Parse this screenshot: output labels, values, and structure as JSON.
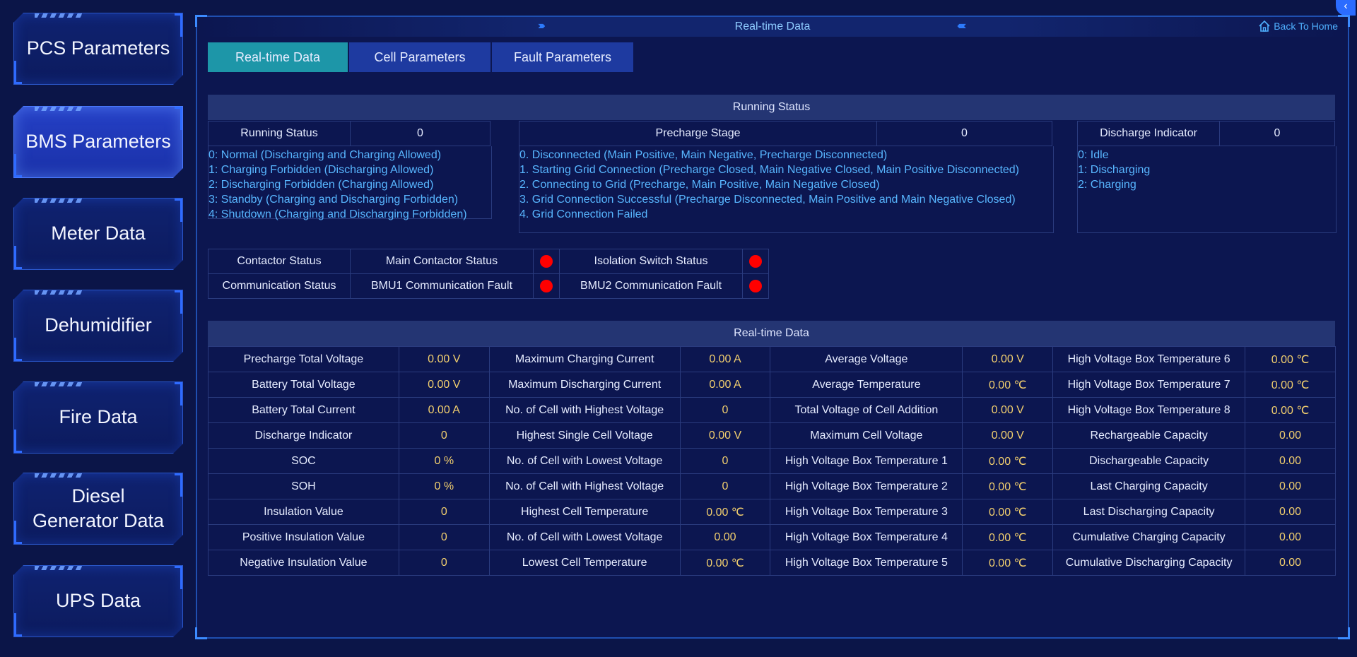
{
  "sidebar": {
    "items": [
      {
        "label": "PCS Parameters",
        "active": false
      },
      {
        "label": "BMS Parameters",
        "active": true
      },
      {
        "label": "Meter Data",
        "active": false
      },
      {
        "label": "Dehumidifier",
        "active": false
      },
      {
        "label": "Fire Data",
        "active": false
      },
      {
        "label": "Diesel Generator Data",
        "active": false
      },
      {
        "label": "UPS Data",
        "active": false
      }
    ]
  },
  "header": {
    "title": "Real-time Data",
    "back_home": "Back To Home"
  },
  "tabs": [
    "Real-time Data",
    "Cell Parameters",
    "Fault Parameters"
  ],
  "running_status": {
    "section_title": "Running Status",
    "running": {
      "label": "Running Status",
      "value": "0",
      "options": [
        "0: Normal (Discharging and Charging Allowed)",
        "1: Charging Forbidden (Discharging Allowed)",
        "2: Discharging Forbidden (Charging Allowed)",
        "3: Standby (Charging and Discharging Forbidden)",
        "4: Shutdown (Charging and Discharging Forbidden)"
      ]
    },
    "precharge": {
      "label": "Precharge Stage",
      "value": "0",
      "options": [
        "0. Disconnected (Main Positive, Main Negative, Precharge Disconnected)",
        "1. Starting Grid Connection (Precharge Closed, Main Negative Closed, Main Positive Disconnected)",
        "2. Connecting to Grid (Precharge, Main Positive, Main Negative Closed)",
        "3. Grid Connection Successful (Precharge Disconnected, Main Positive and Main Negative Closed)",
        "4. Grid Connection Failed"
      ]
    },
    "discharge": {
      "label": "Discharge Indicator",
      "value": "0",
      "options": [
        "0: Idle",
        "1: Discharging",
        "2: Charging"
      ]
    }
  },
  "status_grid": {
    "contactor_label": "Contactor Status",
    "main_contactor": "Main Contactor Status",
    "isolation_switch": "Isolation Switch Status",
    "communication_label": "Communication Status",
    "bmu1": "BMU1 Communication Fault",
    "bmu2": "BMU2 Communication Fault",
    "indicator_color": "#ff0000"
  },
  "realtime": {
    "section_title": "Real-time Data",
    "rows": [
      [
        "Precharge Total Voltage",
        "0.00 V",
        "Maximum Charging Current",
        "0.00 A",
        "Average Voltage",
        "0.00 V",
        "High Voltage Box Temperature 6",
        "0.00 ℃"
      ],
      [
        "Battery Total Voltage",
        "0.00 V",
        "Maximum Discharging Current",
        "0.00 A",
        "Average Temperature",
        "0.00 ℃",
        "High Voltage Box Temperature 7",
        "0.00 ℃"
      ],
      [
        "Battery Total Current",
        "0.00 A",
        "No. of Cell with Highest Voltage",
        "0",
        "Total Voltage of Cell Addition",
        "0.00 V",
        "High Voltage Box Temperature 8",
        "0.00 ℃"
      ],
      [
        "Discharge Indicator",
        "0",
        "Highest Single Cell Voltage",
        "0.00 V",
        "Maximum Cell Voltage",
        "0.00 V",
        "Rechargeable Capacity",
        "0.00"
      ],
      [
        "SOC",
        "0 %",
        "No. of Cell with Lowest Voltage",
        "0",
        "High Voltage Box Temperature 1",
        "0.00 ℃",
        "Dischargeable Capacity",
        "0.00"
      ],
      [
        "SOH",
        "0 %",
        "No. of Cell with Highest Voltage",
        "0",
        "High Voltage Box Temperature 2",
        "0.00 ℃",
        "Last Charging Capacity",
        "0.00"
      ],
      [
        "Insulation Value",
        "0",
        "Highest Cell Temperature",
        "0.00 ℃",
        "High Voltage Box Temperature 3",
        "0.00 ℃",
        "Last Discharging Capacity",
        "0.00"
      ],
      [
        "Positive Insulation Value",
        "0",
        "No. of Cell with Lowest Voltage",
        "0.00",
        "High Voltage Box Temperature 4",
        "0.00 ℃",
        "Cumulative Charging Capacity",
        "0.00"
      ],
      [
        "Negative Insulation Value",
        "0",
        "Lowest Cell Temperature",
        "0.00 ℃",
        "High Voltage Box Temperature 5",
        "0.00 ℃",
        "Cumulative Discharging Capacity",
        "0.00"
      ]
    ]
  }
}
